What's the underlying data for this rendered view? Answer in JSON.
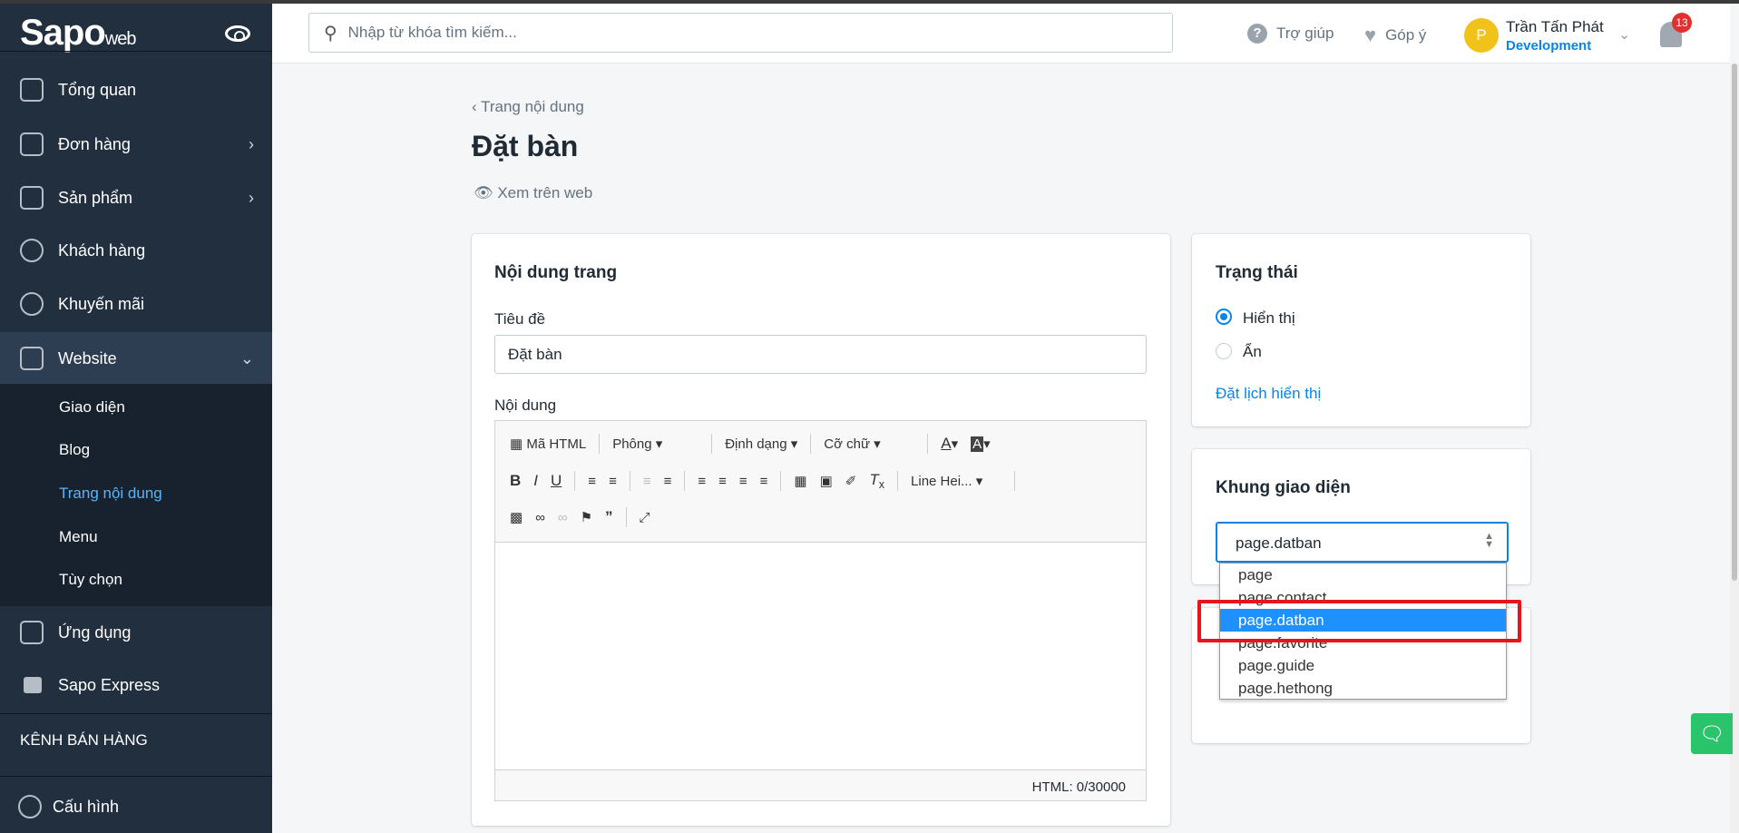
{
  "logo": {
    "brand": "Sapo",
    "suffix": "web"
  },
  "sidebar": {
    "items": [
      {
        "label": "Tổng quan",
        "icon": "home-icon"
      },
      {
        "label": "Đơn hàng",
        "icon": "order-icon",
        "chevron": "›"
      },
      {
        "label": "Sản phẩm",
        "icon": "box-icon",
        "chevron": "›"
      },
      {
        "label": "Khách hàng",
        "icon": "user-icon"
      },
      {
        "label": "Khuyến mãi",
        "icon": "percent-icon"
      },
      {
        "label": "Website",
        "icon": "website-icon",
        "chevron": "⌄"
      }
    ],
    "submenu": [
      "Giao diện",
      "Blog",
      "Trang nội dung",
      "Menu",
      "Tùy chọn"
    ],
    "apps": "Ứng dụng",
    "express": "Sapo Express",
    "channels": "KÊNH BÁN HÀNG",
    "settings": "Cấu hình"
  },
  "header": {
    "search_placeholder": "Nhập từ khóa tìm kiếm...",
    "help": "Trợ giúp",
    "feedback": "Góp ý",
    "avatar_initial": "P",
    "user_name": "Trần Tấn Phát",
    "user_role": "Development",
    "notifications": "13"
  },
  "page": {
    "breadcrumb": "Trang nội dung",
    "title": "Đặt bàn",
    "view_on_web": "Xem trên web"
  },
  "content": {
    "heading": "Nội dung trang",
    "title_label": "Tiêu đề",
    "title_value": "Đặt bàn",
    "content_label": "Nội dung",
    "toolbar": {
      "html": "Mã HTML",
      "font": "Phông",
      "format": "Định dạng",
      "size": "Cỡ chữ",
      "line_height": "Line Hei..."
    },
    "counter": "HTML: 0/30000"
  },
  "status": {
    "heading": "Trạng thái",
    "options": [
      "Hiển thị",
      "Ẩn"
    ],
    "selected": 0,
    "schedule": "Đặt lịch hiển thị"
  },
  "template": {
    "heading": "Khung giao diện",
    "value": "page.datban",
    "options": [
      "page",
      "page.contact",
      "page.datban",
      "page.favorite",
      "page.guide",
      "page.hethong"
    ],
    "highlighted": 2
  },
  "colors": {
    "sidebar": "#212f3f",
    "accent": "#0b84e5",
    "highlight_box": "#e8141a",
    "chat": "#29c46b"
  }
}
